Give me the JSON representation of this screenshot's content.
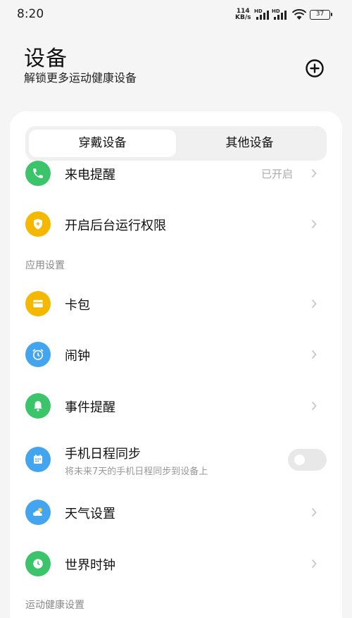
{
  "status_bar": {
    "time": "8:20",
    "net_speed_value": "114",
    "net_speed_unit": "KB/s",
    "hd1": "HD",
    "hd2": "HD",
    "battery": "37"
  },
  "header": {
    "title": "设备",
    "subtitle": "解锁更多运动健康设备",
    "add_icon": "plus-circle-icon"
  },
  "tabs": [
    {
      "label": "穿戴设备",
      "active": true
    },
    {
      "label": "其他设备",
      "active": false
    }
  ],
  "rows": [
    {
      "label": "来电提醒",
      "value": "已开启",
      "icon": "phone-icon",
      "color": "#3cc46b"
    },
    {
      "label": "开启后台运行权限",
      "icon": "shield-icon",
      "color": "#f5b800"
    }
  ],
  "sections": {
    "app_settings": "应用设置",
    "health_settings": "运动健康设置"
  },
  "app_rows": [
    {
      "label": "卡包",
      "icon": "card-icon",
      "color": "#f5b800"
    },
    {
      "label": "闹钟",
      "icon": "alarm-icon",
      "color": "#43a5f0"
    },
    {
      "label": "事件提醒",
      "icon": "bell-icon",
      "color": "#3cc46b"
    },
    {
      "label": "手机日程同步",
      "sublabel": "将未来7天的手机日程同步到设备上",
      "icon": "calendar-icon",
      "color": "#43a5f0",
      "toggle_on": false
    },
    {
      "label": "天气设置",
      "icon": "weather-icon",
      "color": "#43a5f0"
    },
    {
      "label": "世界时钟",
      "icon": "clock-icon",
      "color": "#3cc46b"
    }
  ]
}
